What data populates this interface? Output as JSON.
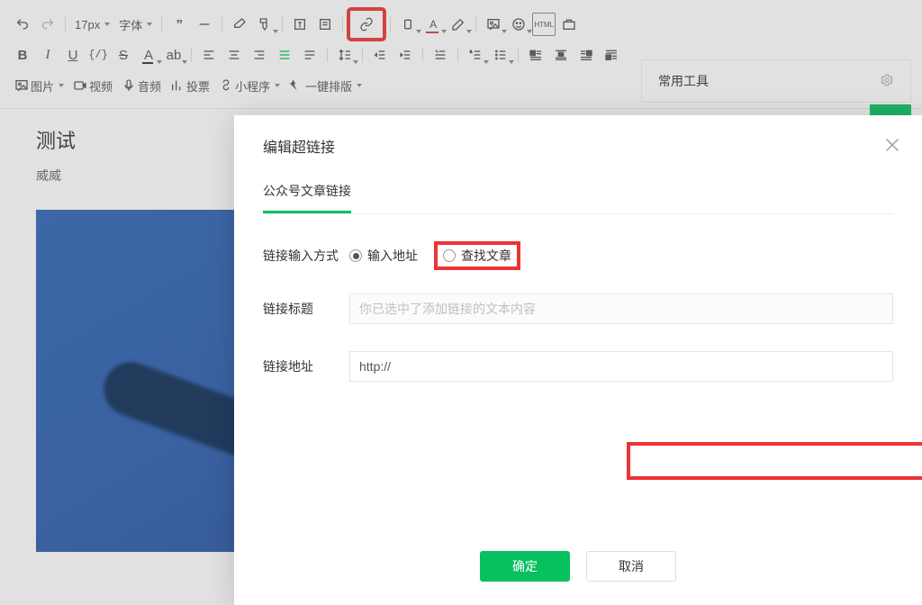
{
  "toolbar": {
    "font_size": "17px",
    "font_family": "字体",
    "row3": {
      "image": "图片",
      "video": "视频",
      "audio": "音频",
      "vote": "投票",
      "miniprog": "小程序",
      "autolayout": "一键排版"
    }
  },
  "side_panel": {
    "title": "常用工具"
  },
  "article": {
    "title": "测试",
    "subtitle": "威威"
  },
  "modal": {
    "title": "编辑超链接",
    "tab": "公众号文章链接",
    "input_type_label": "链接输入方式",
    "radio_url": "输入地址",
    "radio_search": "查找文章",
    "title_label": "链接标题",
    "title_placeholder": "你已选中了添加链接的文本内容",
    "url_label": "链接地址",
    "url_prefix": "http://",
    "ok": "确定",
    "cancel": "取消"
  }
}
